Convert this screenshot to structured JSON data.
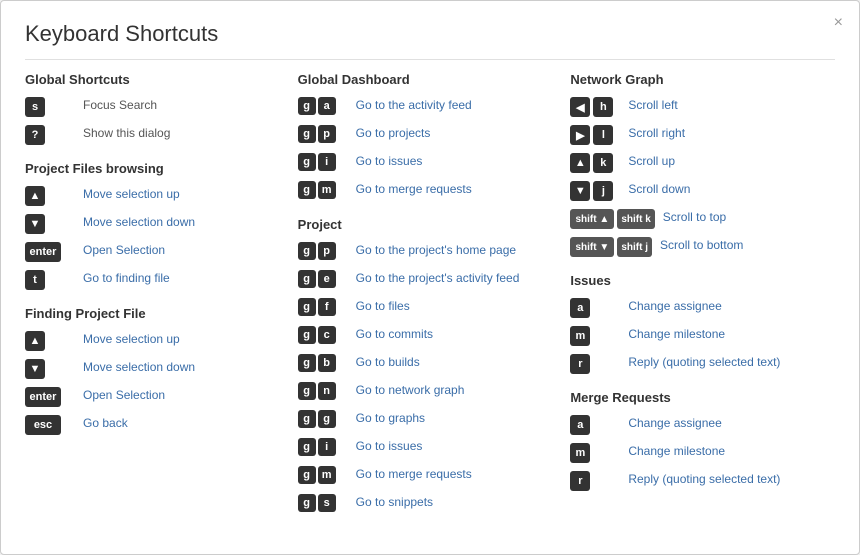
{
  "modal": {
    "title": "Keyboard Shortcuts",
    "close_label": "×"
  },
  "columns": {
    "col1": {
      "sections": [
        {
          "title": "Global Shortcuts",
          "shortcuts": [
            {
              "keys": [
                {
                  "type": "single",
                  "label": "s"
                }
              ],
              "desc": "Focus Search",
              "desc_color": "normal"
            },
            {
              "keys": [
                {
                  "type": "single",
                  "label": "?"
                }
              ],
              "desc": "Show this dialog",
              "desc_color": "normal"
            }
          ]
        },
        {
          "title": "Project Files browsing",
          "shortcuts": [
            {
              "keys": [
                {
                  "type": "arrow_up"
                }
              ],
              "desc": "Move selection up",
              "desc_color": "blue"
            },
            {
              "keys": [
                {
                  "type": "arrow_down"
                }
              ],
              "desc": "Move selection down",
              "desc_color": "blue"
            },
            {
              "keys": [
                {
                  "type": "enter"
                }
              ],
              "desc": "Open Selection",
              "desc_color": "blue"
            },
            {
              "keys": [
                {
                  "type": "single",
                  "label": "t"
                }
              ],
              "desc": "Go to finding file",
              "desc_color": "blue"
            }
          ]
        },
        {
          "title": "Finding Project File",
          "shortcuts": [
            {
              "keys": [
                {
                  "type": "arrow_up"
                }
              ],
              "desc": "Move selection up",
              "desc_color": "blue"
            },
            {
              "keys": [
                {
                  "type": "arrow_down"
                }
              ],
              "desc": "Move selection down",
              "desc_color": "blue"
            },
            {
              "keys": [
                {
                  "type": "enter"
                }
              ],
              "desc": "Open Selection",
              "desc_color": "blue"
            },
            {
              "keys": [
                {
                  "type": "esc"
                }
              ],
              "desc": "Go back",
              "desc_color": "blue"
            }
          ]
        }
      ]
    },
    "col2": {
      "sections": [
        {
          "title": "Global Dashboard",
          "shortcuts": [
            {
              "keys": [
                {
                  "type": "g"
                },
                {
                  "type": "single",
                  "label": "a"
                }
              ],
              "desc": "Go to the activity feed",
              "desc_color": "blue"
            },
            {
              "keys": [
                {
                  "type": "g"
                },
                {
                  "type": "single",
                  "label": "p"
                }
              ],
              "desc": "Go to projects",
              "desc_color": "blue"
            },
            {
              "keys": [
                {
                  "type": "g"
                },
                {
                  "type": "single",
                  "label": "i"
                }
              ],
              "desc": "Go to issues",
              "desc_color": "blue"
            },
            {
              "keys": [
                {
                  "type": "g"
                },
                {
                  "type": "single",
                  "label": "m"
                }
              ],
              "desc": "Go to merge requests",
              "desc_color": "blue"
            }
          ]
        },
        {
          "title": "Project",
          "shortcuts": [
            {
              "keys": [
                {
                  "type": "g"
                },
                {
                  "type": "single",
                  "label": "p"
                }
              ],
              "desc": "Go to the project's home page",
              "desc_color": "blue"
            },
            {
              "keys": [
                {
                  "type": "g"
                },
                {
                  "type": "single",
                  "label": "e"
                }
              ],
              "desc": "Go to the project's activity feed",
              "desc_color": "blue"
            },
            {
              "keys": [
                {
                  "type": "g"
                },
                {
                  "type": "single",
                  "label": "f"
                }
              ],
              "desc": "Go to files",
              "desc_color": "blue"
            },
            {
              "keys": [
                {
                  "type": "g"
                },
                {
                  "type": "single",
                  "label": "c"
                }
              ],
              "desc": "Go to commits",
              "desc_color": "blue"
            },
            {
              "keys": [
                {
                  "type": "g"
                },
                {
                  "type": "single",
                  "label": "b"
                }
              ],
              "desc": "Go to builds",
              "desc_color": "blue"
            },
            {
              "keys": [
                {
                  "type": "g"
                },
                {
                  "type": "single",
                  "label": "n"
                }
              ],
              "desc": "Go to network graph",
              "desc_color": "blue"
            },
            {
              "keys": [
                {
                  "type": "g"
                },
                {
                  "type": "single",
                  "label": "g"
                }
              ],
              "desc": "Go to graphs",
              "desc_color": "blue"
            },
            {
              "keys": [
                {
                  "type": "g"
                },
                {
                  "type": "single",
                  "label": "i"
                }
              ],
              "desc": "Go to issues",
              "desc_color": "blue"
            },
            {
              "keys": [
                {
                  "type": "g"
                },
                {
                  "type": "single",
                  "label": "m"
                }
              ],
              "desc": "Go to merge requests",
              "desc_color": "blue"
            },
            {
              "keys": [
                {
                  "type": "g"
                },
                {
                  "type": "single",
                  "label": "s"
                }
              ],
              "desc": "Go to snippets",
              "desc_color": "blue"
            }
          ]
        }
      ]
    },
    "col3": {
      "sections": [
        {
          "title": "Network Graph",
          "shortcuts": [
            {
              "keys": [
                {
                  "type": "arrow_left_box"
                },
                {
                  "type": "single",
                  "label": "h"
                }
              ],
              "desc": "Scroll left",
              "desc_color": "blue"
            },
            {
              "keys": [
                {
                  "type": "arrow_right_box"
                },
                {
                  "type": "single",
                  "label": "l"
                }
              ],
              "desc": "Scroll right",
              "desc_color": "blue"
            },
            {
              "keys": [
                {
                  "type": "arrow_up_box"
                },
                {
                  "type": "single",
                  "label": "k"
                }
              ],
              "desc": "Scroll up",
              "desc_color": "blue"
            },
            {
              "keys": [
                {
                  "type": "arrow_down_box"
                },
                {
                  "type": "single",
                  "label": "j"
                }
              ],
              "desc": "Scroll down",
              "desc_color": "blue"
            },
            {
              "keys": [
                {
                  "type": "shift_up"
                },
                {
                  "type": "shift_k"
                }
              ],
              "desc": "Scroll to top",
              "desc_color": "blue"
            },
            {
              "keys": [
                {
                  "type": "shift_down"
                },
                {
                  "type": "shift_j"
                }
              ],
              "desc": "Scroll to bottom",
              "desc_color": "blue"
            }
          ]
        },
        {
          "title": "Issues",
          "shortcuts": [
            {
              "keys": [
                {
                  "type": "single",
                  "label": "a"
                }
              ],
              "desc": "Change assignee",
              "desc_color": "blue"
            },
            {
              "keys": [
                {
                  "type": "single",
                  "label": "m"
                }
              ],
              "desc": "Change milestone",
              "desc_color": "blue"
            },
            {
              "keys": [
                {
                  "type": "single",
                  "label": "r"
                }
              ],
              "desc": "Reply (quoting selected text)",
              "desc_color": "blue"
            }
          ]
        },
        {
          "title": "Merge Requests",
          "shortcuts": [
            {
              "keys": [
                {
                  "type": "single",
                  "label": "a"
                }
              ],
              "desc": "Change assignee",
              "desc_color": "blue"
            },
            {
              "keys": [
                {
                  "type": "single",
                  "label": "m"
                }
              ],
              "desc": "Change milestone",
              "desc_color": "blue"
            },
            {
              "keys": [
                {
                  "type": "single",
                  "label": "r"
                }
              ],
              "desc": "Reply (quoting selected text)",
              "desc_color": "blue"
            }
          ]
        }
      ]
    }
  }
}
